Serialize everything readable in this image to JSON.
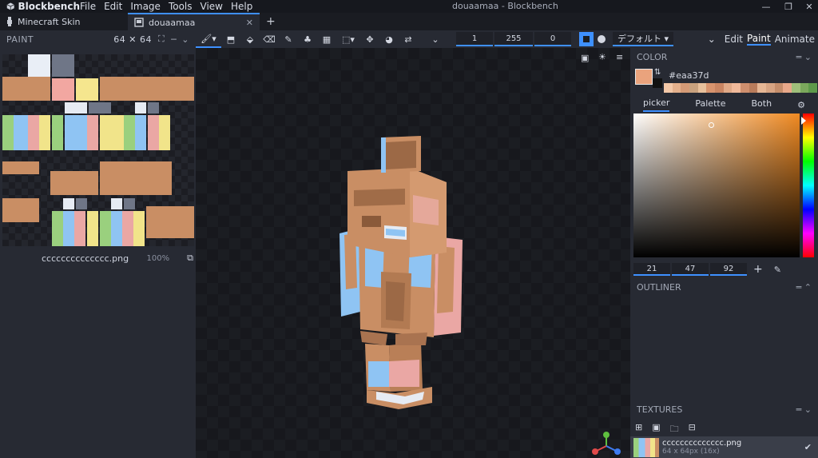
{
  "app": {
    "name": "Blockbench",
    "window_title": "douaamaa - Blockbench"
  },
  "menu": [
    "File",
    "Edit",
    "Image",
    "Tools",
    "View",
    "Help"
  ],
  "tabs": [
    {
      "label": "Minecraft Skin"
    },
    {
      "label": "douaamaa"
    }
  ],
  "toolbar": {
    "brush_size": "1",
    "opacity": "255",
    "softness": "0",
    "language_mode": "デフォルト",
    "modes": [
      "Edit",
      "Paint",
      "Animate"
    ],
    "active_mode": "Paint"
  },
  "paint_panel": {
    "title": "PAINT",
    "resolution": "64 ✕ 64",
    "texture_name": "cccccccccccccc.png",
    "zoom": "100%"
  },
  "color_panel": {
    "title": "COLOR",
    "hex": "#eaa37d",
    "current_color": "#eaa37d",
    "tabs": [
      "picker",
      "Palette",
      "Both"
    ],
    "active_tab": "picker",
    "rgb": [
      "21",
      "47",
      "92"
    ],
    "palette": [
      "#f3c8a8",
      "#e4b08c",
      "#d49a76",
      "#c9a27e",
      "#e8c19c",
      "#d8946e",
      "#c98562",
      "#e0a987",
      "#f0b99a",
      "#cf8f6e",
      "#b97c5b",
      "#e6b795",
      "#d7a483",
      "#c48d6b",
      "#e8a88a",
      "#9fbf7a",
      "#7ba85c",
      "#5e9a4a"
    ]
  },
  "outliner_panel": {
    "title": "OUTLINER"
  },
  "textures_panel": {
    "title": "TEXTURES",
    "items": [
      {
        "name": "cccccccccccccc.png",
        "meta": "64 x 64px (16x)"
      }
    ]
  },
  "colors": {
    "accent": "#3e90ff",
    "panel": "#272a33",
    "skin": "#c98e64",
    "blue": "#8fc4f3",
    "pink": "#eaa7a4",
    "green": "#9ad07e",
    "yellow": "#f1e48a"
  }
}
